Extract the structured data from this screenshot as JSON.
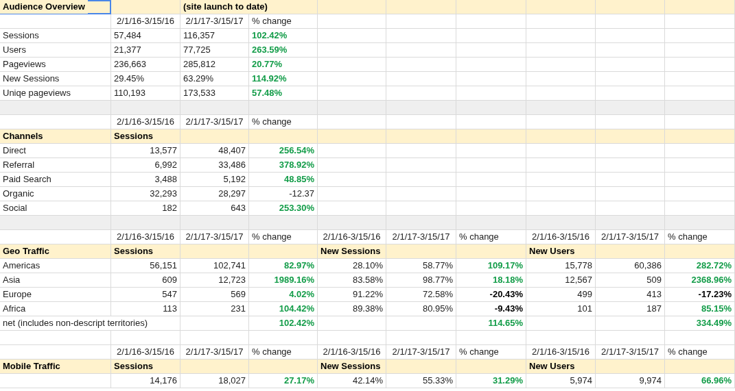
{
  "sheet": {
    "rows": [
      {
        "kind": "header",
        "cells": [
          {
            "kind": "heading",
            "text": "Audience Overview",
            "selected": true
          },
          {
            "kind": "empty",
            "selected": false
          },
          {
            "kind": "heading",
            "text": "(site launch to date)",
            "selected": false
          },
          {
            "kind": "empty",
            "selected": false
          },
          {
            "kind": "empty",
            "selected": false
          },
          {
            "kind": "empty",
            "selected": false
          },
          {
            "kind": "empty",
            "selected": false
          },
          {
            "kind": "empty",
            "selected": false
          },
          {
            "kind": "empty",
            "selected": false
          },
          {
            "kind": "empty",
            "selected": false
          }
        ]
      },
      {
        "kind": "plain",
        "cells": [
          {
            "kind": "empty",
            "selected": false
          },
          {
            "kind": "date",
            "text": "2/1/16-3/15/16",
            "selected": false
          },
          {
            "kind": "date",
            "text": "2/1/17-3/15/17",
            "selected": false
          },
          {
            "kind": "text",
            "text": "% change",
            "selected": false
          },
          {
            "kind": "empty",
            "selected": false
          },
          {
            "kind": "empty",
            "selected": false
          },
          {
            "kind": "empty",
            "selected": false
          },
          {
            "kind": "empty",
            "selected": false
          },
          {
            "kind": "empty",
            "selected": false
          },
          {
            "kind": "empty",
            "selected": false
          }
        ]
      },
      {
        "kind": "plain",
        "cells": [
          {
            "kind": "text",
            "text": "Sessions",
            "selected": false
          },
          {
            "kind": "text",
            "text": "57,484",
            "selected": false
          },
          {
            "kind": "text",
            "text": "116,357",
            "selected": false
          },
          {
            "kind": "gain",
            "right_aligned": false,
            "text": "102.42%",
            "selected": false
          },
          {
            "kind": "empty",
            "selected": false
          },
          {
            "kind": "empty",
            "selected": false
          },
          {
            "kind": "empty",
            "selected": false
          },
          {
            "kind": "empty",
            "selected": false
          },
          {
            "kind": "empty",
            "selected": false
          },
          {
            "kind": "empty",
            "selected": false
          }
        ]
      },
      {
        "kind": "plain",
        "cells": [
          {
            "kind": "text",
            "text": "Users",
            "selected": false
          },
          {
            "kind": "text",
            "text": "21,377",
            "selected": false
          },
          {
            "kind": "text",
            "text": "77,725",
            "selected": false
          },
          {
            "kind": "gain",
            "right_aligned": false,
            "text": "263.59%",
            "selected": false
          },
          {
            "kind": "empty",
            "selected": false
          },
          {
            "kind": "empty",
            "selected": false
          },
          {
            "kind": "empty",
            "selected": false
          },
          {
            "kind": "empty",
            "selected": false
          },
          {
            "kind": "empty",
            "selected": false
          },
          {
            "kind": "empty",
            "selected": false
          }
        ]
      },
      {
        "kind": "plain",
        "cells": [
          {
            "kind": "text",
            "text": "Pageviews",
            "selected": false
          },
          {
            "kind": "text",
            "text": "236,663",
            "selected": false
          },
          {
            "kind": "text",
            "text": "285,812",
            "selected": false
          },
          {
            "kind": "gain",
            "right_aligned": false,
            "text": "20.77%",
            "selected": false
          },
          {
            "kind": "empty",
            "selected": false
          },
          {
            "kind": "empty",
            "selected": false
          },
          {
            "kind": "empty",
            "selected": false
          },
          {
            "kind": "empty",
            "selected": false
          },
          {
            "kind": "empty",
            "selected": false
          },
          {
            "kind": "empty",
            "selected": false
          }
        ]
      },
      {
        "kind": "plain",
        "cells": [
          {
            "kind": "text",
            "text": "New Sessions",
            "selected": false
          },
          {
            "kind": "text",
            "text": "29.45%",
            "selected": false
          },
          {
            "kind": "text",
            "text": "63.29%",
            "selected": false
          },
          {
            "kind": "gain",
            "right_aligned": false,
            "text": "114.92%",
            "selected": false
          },
          {
            "kind": "empty",
            "selected": false
          },
          {
            "kind": "empty",
            "selected": false
          },
          {
            "kind": "empty",
            "selected": false
          },
          {
            "kind": "empty",
            "selected": false
          },
          {
            "kind": "empty",
            "selected": false
          },
          {
            "kind": "empty",
            "selected": false
          }
        ]
      },
      {
        "kind": "plain",
        "cells": [
          {
            "kind": "text",
            "text": "Uniqe pageviews",
            "selected": false
          },
          {
            "kind": "text",
            "text": "110,193",
            "selected": false
          },
          {
            "kind": "text",
            "text": "173,533",
            "selected": false
          },
          {
            "kind": "gain",
            "right_aligned": false,
            "text": "57.48%",
            "selected": false
          },
          {
            "kind": "empty",
            "selected": false
          },
          {
            "kind": "empty",
            "selected": false
          },
          {
            "kind": "empty",
            "selected": false
          },
          {
            "kind": "empty",
            "selected": false
          },
          {
            "kind": "empty",
            "selected": false
          },
          {
            "kind": "empty",
            "selected": false
          }
        ]
      },
      {
        "kind": "band",
        "cells": [
          {
            "kind": "empty",
            "selected": false
          },
          {
            "kind": "empty",
            "selected": false
          },
          {
            "kind": "empty",
            "selected": false
          },
          {
            "kind": "empty",
            "selected": false
          },
          {
            "kind": "empty",
            "selected": false
          },
          {
            "kind": "empty",
            "selected": false
          },
          {
            "kind": "empty",
            "selected": false
          },
          {
            "kind": "empty",
            "selected": false
          },
          {
            "kind": "empty",
            "selected": false
          },
          {
            "kind": "empty",
            "selected": false
          }
        ]
      },
      {
        "kind": "plain",
        "cells": [
          {
            "kind": "empty",
            "selected": false
          },
          {
            "kind": "date",
            "text": "2/1/16-3/15/16",
            "selected": false
          },
          {
            "kind": "date",
            "text": "2/1/17-3/15/17",
            "selected": false
          },
          {
            "kind": "text",
            "text": "% change",
            "selected": false
          },
          {
            "kind": "empty",
            "selected": false
          },
          {
            "kind": "empty",
            "selected": false
          },
          {
            "kind": "empty",
            "selected": false
          },
          {
            "kind": "empty",
            "selected": false
          },
          {
            "kind": "empty",
            "selected": false
          },
          {
            "kind": "empty",
            "selected": false
          }
        ]
      },
      {
        "kind": "header",
        "cells": [
          {
            "kind": "heading",
            "text": "Channels",
            "selected": false
          },
          {
            "kind": "heading",
            "text": "Sessions",
            "selected": false
          },
          {
            "kind": "empty",
            "selected": false
          },
          {
            "kind": "empty",
            "selected": false
          },
          {
            "kind": "empty",
            "selected": false
          },
          {
            "kind": "empty",
            "selected": false
          },
          {
            "kind": "empty",
            "selected": false
          },
          {
            "kind": "empty",
            "selected": false
          },
          {
            "kind": "empty",
            "selected": false
          },
          {
            "kind": "empty",
            "selected": false
          }
        ]
      },
      {
        "kind": "plain",
        "cells": [
          {
            "kind": "text",
            "text": "Direct",
            "selected": false
          },
          {
            "kind": "value",
            "text": "13,577",
            "selected": false
          },
          {
            "kind": "value",
            "text": "48,407",
            "selected": false
          },
          {
            "kind": "gain",
            "right_aligned": true,
            "text": "256.54%",
            "selected": false
          },
          {
            "kind": "empty",
            "selected": false
          },
          {
            "kind": "empty",
            "selected": false
          },
          {
            "kind": "empty",
            "selected": false
          },
          {
            "kind": "empty",
            "selected": false
          },
          {
            "kind": "empty",
            "selected": false
          },
          {
            "kind": "empty",
            "selected": false
          }
        ]
      },
      {
        "kind": "plain",
        "cells": [
          {
            "kind": "text",
            "text": "Referral",
            "selected": false
          },
          {
            "kind": "value",
            "text": "6,992",
            "selected": false
          },
          {
            "kind": "value",
            "text": "33,486",
            "selected": false
          },
          {
            "kind": "gain",
            "right_aligned": true,
            "text": "378.92%",
            "selected": false
          },
          {
            "kind": "empty",
            "selected": false
          },
          {
            "kind": "empty",
            "selected": false
          },
          {
            "kind": "empty",
            "selected": false
          },
          {
            "kind": "empty",
            "selected": false
          },
          {
            "kind": "empty",
            "selected": false
          },
          {
            "kind": "empty",
            "selected": false
          }
        ]
      },
      {
        "kind": "plain",
        "cells": [
          {
            "kind": "text",
            "text": "Paid Search",
            "selected": false
          },
          {
            "kind": "value",
            "text": "3,488",
            "selected": false
          },
          {
            "kind": "value",
            "text": "5,192",
            "selected": false
          },
          {
            "kind": "gain",
            "right_aligned": true,
            "text": "48.85%",
            "selected": false
          },
          {
            "kind": "empty",
            "selected": false
          },
          {
            "kind": "empty",
            "selected": false
          },
          {
            "kind": "empty",
            "selected": false
          },
          {
            "kind": "empty",
            "selected": false
          },
          {
            "kind": "empty",
            "selected": false
          },
          {
            "kind": "empty",
            "selected": false
          }
        ]
      },
      {
        "kind": "plain",
        "cells": [
          {
            "kind": "text",
            "text": "Organic",
            "selected": false
          },
          {
            "kind": "value",
            "text": "32,293",
            "selected": false
          },
          {
            "kind": "value",
            "text": "28,297",
            "selected": false
          },
          {
            "kind": "value",
            "text": "-12.37",
            "selected": false
          },
          {
            "kind": "empty",
            "selected": false
          },
          {
            "kind": "empty",
            "selected": false
          },
          {
            "kind": "empty",
            "selected": false
          },
          {
            "kind": "empty",
            "selected": false
          },
          {
            "kind": "empty",
            "selected": false
          },
          {
            "kind": "empty",
            "selected": false
          }
        ]
      },
      {
        "kind": "plain",
        "cells": [
          {
            "kind": "text",
            "text": "Social",
            "selected": false
          },
          {
            "kind": "value",
            "text": "182",
            "selected": false
          },
          {
            "kind": "value",
            "text": "643",
            "selected": false
          },
          {
            "kind": "gain",
            "right_aligned": true,
            "text": "253.30%",
            "selected": false
          },
          {
            "kind": "empty",
            "selected": false
          },
          {
            "kind": "empty",
            "selected": false
          },
          {
            "kind": "empty",
            "selected": false
          },
          {
            "kind": "empty",
            "selected": false
          },
          {
            "kind": "empty",
            "selected": false
          },
          {
            "kind": "empty",
            "selected": false
          }
        ]
      },
      {
        "kind": "band",
        "cells": [
          {
            "kind": "empty",
            "selected": false
          },
          {
            "kind": "empty",
            "selected": false
          },
          {
            "kind": "empty",
            "selected": false
          },
          {
            "kind": "empty",
            "selected": false
          },
          {
            "kind": "empty",
            "selected": false
          },
          {
            "kind": "empty",
            "selected": false
          },
          {
            "kind": "empty",
            "selected": false
          },
          {
            "kind": "empty",
            "selected": false
          },
          {
            "kind": "empty",
            "selected": false
          },
          {
            "kind": "empty",
            "selected": false
          }
        ]
      },
      {
        "kind": "plain",
        "cells": [
          {
            "kind": "empty",
            "selected": false
          },
          {
            "kind": "date",
            "text": "2/1/16-3/15/16",
            "selected": false
          },
          {
            "kind": "date",
            "text": "2/1/17-3/15/17",
            "selected": false
          },
          {
            "kind": "text",
            "text": "% change",
            "selected": false
          },
          {
            "kind": "date",
            "text": "2/1/16-3/15/16",
            "selected": false
          },
          {
            "kind": "date",
            "text": "2/1/17-3/15/17",
            "selected": false
          },
          {
            "kind": "text",
            "text": "% change",
            "selected": false
          },
          {
            "kind": "date",
            "text": "2/1/16-3/15/16",
            "selected": false
          },
          {
            "kind": "date",
            "text": "2/1/17-3/15/17",
            "selected": false
          },
          {
            "kind": "text",
            "text": "% change",
            "selected": false
          }
        ]
      },
      {
        "kind": "header",
        "cells": [
          {
            "kind": "heading",
            "text": "Geo Traffic",
            "selected": false
          },
          {
            "kind": "heading",
            "text": "Sessions",
            "selected": false
          },
          {
            "kind": "empty",
            "selected": false
          },
          {
            "kind": "empty",
            "selected": false
          },
          {
            "kind": "heading",
            "text": "New Sessions",
            "selected": false
          },
          {
            "kind": "empty",
            "selected": false
          },
          {
            "kind": "empty",
            "selected": false
          },
          {
            "kind": "heading",
            "text": "New Users",
            "selected": false
          },
          {
            "kind": "empty",
            "selected": false
          },
          {
            "kind": "empty",
            "selected": false
          }
        ]
      },
      {
        "kind": "plain",
        "cells": [
          {
            "kind": "text",
            "text": "Americas",
            "selected": false
          },
          {
            "kind": "value",
            "text": "56,151",
            "selected": false
          },
          {
            "kind": "value",
            "text": "102,741",
            "selected": false
          },
          {
            "kind": "gain",
            "right_aligned": true,
            "text": "82.97%",
            "selected": false
          },
          {
            "kind": "value",
            "text": "28.10%",
            "selected": false
          },
          {
            "kind": "value",
            "text": "58.77%",
            "selected": false
          },
          {
            "kind": "gain",
            "right_aligned": true,
            "text": "109.17%",
            "selected": false
          },
          {
            "kind": "value",
            "text": "15,778",
            "selected": false
          },
          {
            "kind": "value",
            "text": "60,386",
            "selected": false
          },
          {
            "kind": "gain",
            "right_aligned": true,
            "text": "282.72%",
            "selected": false
          }
        ]
      },
      {
        "kind": "plain",
        "cells": [
          {
            "kind": "text",
            "text": "Asia",
            "selected": false
          },
          {
            "kind": "value",
            "text": "609",
            "selected": false
          },
          {
            "kind": "value",
            "text": "12,723",
            "selected": false
          },
          {
            "kind": "gain",
            "right_aligned": true,
            "text": "1989.16%",
            "selected": false
          },
          {
            "kind": "value",
            "text": "83.58%",
            "selected": false
          },
          {
            "kind": "value",
            "text": "98.77%",
            "selected": false
          },
          {
            "kind": "gain",
            "right_aligned": true,
            "text": "18.18%",
            "selected": false
          },
          {
            "kind": "value",
            "text": "12,567",
            "selected": false
          },
          {
            "kind": "value",
            "text": "509",
            "selected": false
          },
          {
            "kind": "gain",
            "right_aligned": true,
            "text": "2368.96%",
            "selected": false
          }
        ]
      },
      {
        "kind": "plain",
        "cells": [
          {
            "kind": "text",
            "text": "Europe",
            "selected": false
          },
          {
            "kind": "value",
            "text": "547",
            "selected": false
          },
          {
            "kind": "value",
            "text": "569",
            "selected": false
          },
          {
            "kind": "gain",
            "right_aligned": true,
            "text": "4.02%",
            "selected": false
          },
          {
            "kind": "value",
            "text": "91.22%",
            "selected": false
          },
          {
            "kind": "value",
            "text": "72.58%",
            "selected": false
          },
          {
            "kind": "loss",
            "right_aligned": true,
            "text": "-20.43%",
            "selected": false
          },
          {
            "kind": "value",
            "text": "499",
            "selected": false
          },
          {
            "kind": "value",
            "text": "413",
            "selected": false
          },
          {
            "kind": "loss",
            "right_aligned": true,
            "text": "-17.23%",
            "selected": false
          }
        ]
      },
      {
        "kind": "plain",
        "cells": [
          {
            "kind": "text",
            "text": "Africa",
            "selected": false
          },
          {
            "kind": "value",
            "text": "113",
            "selected": false
          },
          {
            "kind": "value",
            "text": "231",
            "selected": false
          },
          {
            "kind": "gain",
            "right_aligned": true,
            "text": "104.42%",
            "selected": false
          },
          {
            "kind": "value",
            "text": "89.38%",
            "selected": false
          },
          {
            "kind": "value",
            "text": "80.95%",
            "selected": false
          },
          {
            "kind": "loss",
            "right_aligned": true,
            "text": "-9.43%",
            "selected": false
          },
          {
            "kind": "value",
            "text": "101",
            "selected": false
          },
          {
            "kind": "value",
            "text": "187",
            "selected": false
          },
          {
            "kind": "gain",
            "right_aligned": true,
            "text": "85.15%",
            "selected": false
          }
        ]
      },
      {
        "kind": "plain",
        "cells": [
          {
            "kind": "text",
            "text": "net (includes non-descript territories)",
            "selected": false
          },
          {
            "kind": "empty",
            "selected": false
          },
          {
            "kind": "empty",
            "selected": false
          },
          {
            "kind": "gain",
            "right_aligned": true,
            "text": "102.42%",
            "selected": false
          },
          {
            "kind": "empty",
            "selected": false
          },
          {
            "kind": "empty",
            "selected": false
          },
          {
            "kind": "gain",
            "right_aligned": true,
            "text": "114.65%",
            "selected": false
          },
          {
            "kind": "empty",
            "selected": false
          },
          {
            "kind": "empty",
            "selected": false
          },
          {
            "kind": "gain",
            "right_aligned": true,
            "text": "334.49%",
            "selected": false
          }
        ]
      },
      {
        "kind": "plain",
        "cells": [
          {
            "kind": "empty",
            "selected": false
          },
          {
            "kind": "empty",
            "selected": false
          },
          {
            "kind": "empty",
            "selected": false
          },
          {
            "kind": "empty",
            "selected": false
          },
          {
            "kind": "empty",
            "selected": false
          },
          {
            "kind": "empty",
            "selected": false
          },
          {
            "kind": "empty",
            "selected": false
          },
          {
            "kind": "empty",
            "selected": false
          },
          {
            "kind": "empty",
            "selected": false
          },
          {
            "kind": "empty",
            "selected": false
          }
        ]
      },
      {
        "kind": "plain",
        "cells": [
          {
            "kind": "empty",
            "selected": false
          },
          {
            "kind": "date",
            "text": "2/1/16-3/15/16",
            "selected": false
          },
          {
            "kind": "date",
            "text": "2/1/17-3/15/17",
            "selected": false
          },
          {
            "kind": "text",
            "text": "% change",
            "selected": false
          },
          {
            "kind": "date",
            "text": "2/1/16-3/15/16",
            "selected": false
          },
          {
            "kind": "date",
            "text": "2/1/17-3/15/17",
            "selected": false
          },
          {
            "kind": "text",
            "text": "% change",
            "selected": false
          },
          {
            "kind": "date",
            "text": "2/1/16-3/15/16",
            "selected": false
          },
          {
            "kind": "date",
            "text": "2/1/17-3/15/17",
            "selected": false
          },
          {
            "kind": "text",
            "text": "% change",
            "selected": false
          }
        ]
      },
      {
        "kind": "header",
        "cells": [
          {
            "kind": "heading",
            "text": "Mobile Traffic",
            "selected": false
          },
          {
            "kind": "heading",
            "text": "Sessions",
            "selected": false
          },
          {
            "kind": "empty",
            "selected": false
          },
          {
            "kind": "empty",
            "selected": false
          },
          {
            "kind": "heading",
            "text": "New Sessions",
            "selected": false
          },
          {
            "kind": "empty",
            "selected": false
          },
          {
            "kind": "empty",
            "selected": false
          },
          {
            "kind": "heading",
            "text": "New Users",
            "selected": false
          },
          {
            "kind": "empty",
            "selected": false
          },
          {
            "kind": "empty",
            "selected": false
          }
        ]
      },
      {
        "kind": "plain",
        "cells": [
          {
            "kind": "empty",
            "selected": false
          },
          {
            "kind": "value",
            "text": "14,176",
            "selected": false
          },
          {
            "kind": "value",
            "text": "18,027",
            "selected": false
          },
          {
            "kind": "gain",
            "right_aligned": true,
            "text": "27.17%",
            "selected": false
          },
          {
            "kind": "value",
            "text": "42.14%",
            "selected": false
          },
          {
            "kind": "value",
            "text": "55.33%",
            "selected": false
          },
          {
            "kind": "gain",
            "right_aligned": true,
            "text": "31.29%",
            "selected": false
          },
          {
            "kind": "value",
            "text": "5,974",
            "selected": false
          },
          {
            "kind": "value",
            "text": "9,974",
            "selected": false
          },
          {
            "kind": "gain",
            "right_aligned": true,
            "text": "66.96%",
            "selected": false
          }
        ]
      }
    ]
  }
}
